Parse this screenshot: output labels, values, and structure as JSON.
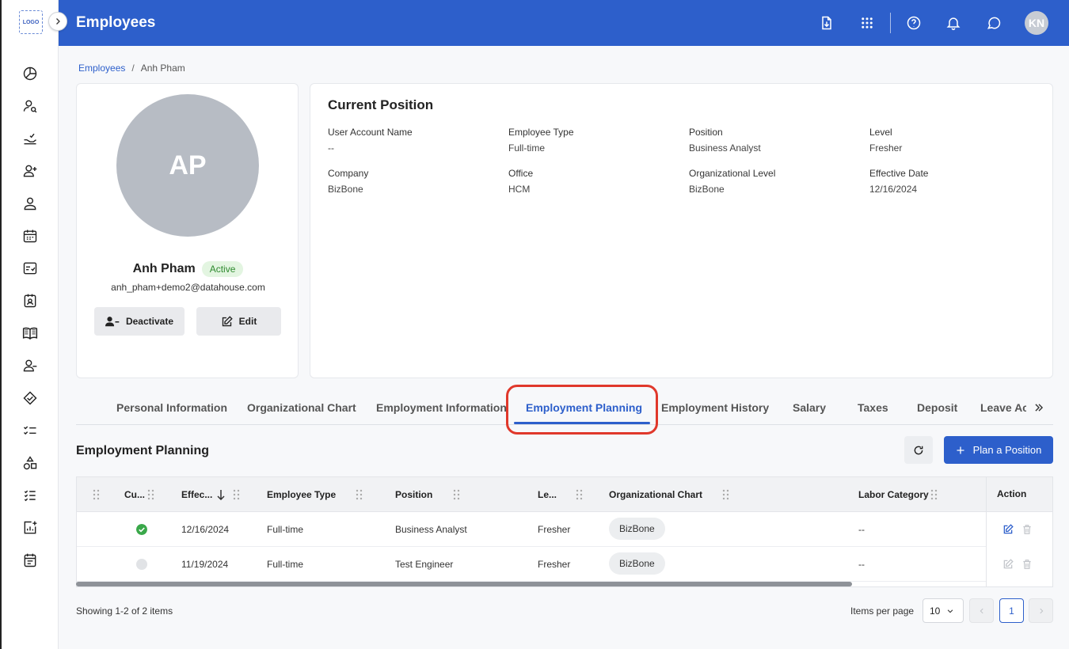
{
  "logo": {
    "text": "LOGO"
  },
  "header": {
    "title": "Employees",
    "avatar_initials": "KN",
    "icons": [
      "download-file-icon",
      "apps-grid-icon",
      "help-icon",
      "bell-icon",
      "chat-icon"
    ]
  },
  "sidebar": {
    "items": [
      "dashboard-icon",
      "user-search-icon",
      "hand-check-icon",
      "user-add-icon",
      "user-icon",
      "calendar-icon",
      "checklist-icon",
      "contact-card-icon",
      "book-icon",
      "user-remove-icon",
      "handshake-icon",
      "task-list-icon",
      "shapes-icon",
      "list-check-icon",
      "chart-add-icon",
      "calendar-note-icon"
    ]
  },
  "breadcrumb": {
    "parent": "Employees",
    "separator": "/",
    "current": "Anh Pham"
  },
  "profile": {
    "initials": "AP",
    "name": "Anh Pham",
    "status": "Active",
    "email": "anh_pham+demo2@datahouse.com",
    "deactivate_label": "Deactivate",
    "edit_label": "Edit"
  },
  "current_position": {
    "title": "Current Position",
    "fields": [
      {
        "label": "User Account Name",
        "value": "--"
      },
      {
        "label": "Employee Type",
        "value": "Full-time"
      },
      {
        "label": "Position",
        "value": "Business Analyst"
      },
      {
        "label": "Level",
        "value": "Fresher"
      },
      {
        "label": "Company",
        "value": "BizBone"
      },
      {
        "label": "Office",
        "value": "HCM"
      },
      {
        "label": "Organizational Level",
        "value": "BizBone"
      },
      {
        "label": "Effective Date",
        "value": "12/16/2024"
      }
    ]
  },
  "tabs": [
    {
      "label": "Personal Information"
    },
    {
      "label": "Organizational Chart"
    },
    {
      "label": "Employment Information"
    },
    {
      "label": "Employment Planning",
      "active": true
    },
    {
      "label": "Employment History"
    },
    {
      "label": "Salary"
    },
    {
      "label": "Taxes"
    },
    {
      "label": "Deposit"
    },
    {
      "label": "Leave Ac"
    }
  ],
  "section": {
    "title": "Employment Planning",
    "plan_button": "Plan a Position"
  },
  "table": {
    "headers": {
      "current": "Cu...",
      "effective": "Effec...",
      "employee_type": "Employee Type",
      "position": "Position",
      "level": "Le...",
      "org_chart": "Organizational Chart",
      "labor_category": "Labor Category",
      "action": "Action"
    },
    "rows": [
      {
        "current": true,
        "effective": "12/16/2024",
        "employee_type": "Full-time",
        "position": "Business Analyst",
        "level": "Fresher",
        "org_chart": "BizBone",
        "labor_category": "--"
      },
      {
        "current": false,
        "effective": "11/19/2024",
        "employee_type": "Full-time",
        "position": "Test Engineer",
        "level": "Fresher",
        "org_chart": "BizBone",
        "labor_category": "--"
      }
    ]
  },
  "footer": {
    "showing": "Showing 1-2 of 2 items",
    "items_per_page_label": "Items per page",
    "items_per_page": "10",
    "current_page": "1"
  },
  "colors": {
    "primary": "#2d5fcb",
    "highlight": "#e0382b",
    "active_green": "#3aa84a"
  }
}
